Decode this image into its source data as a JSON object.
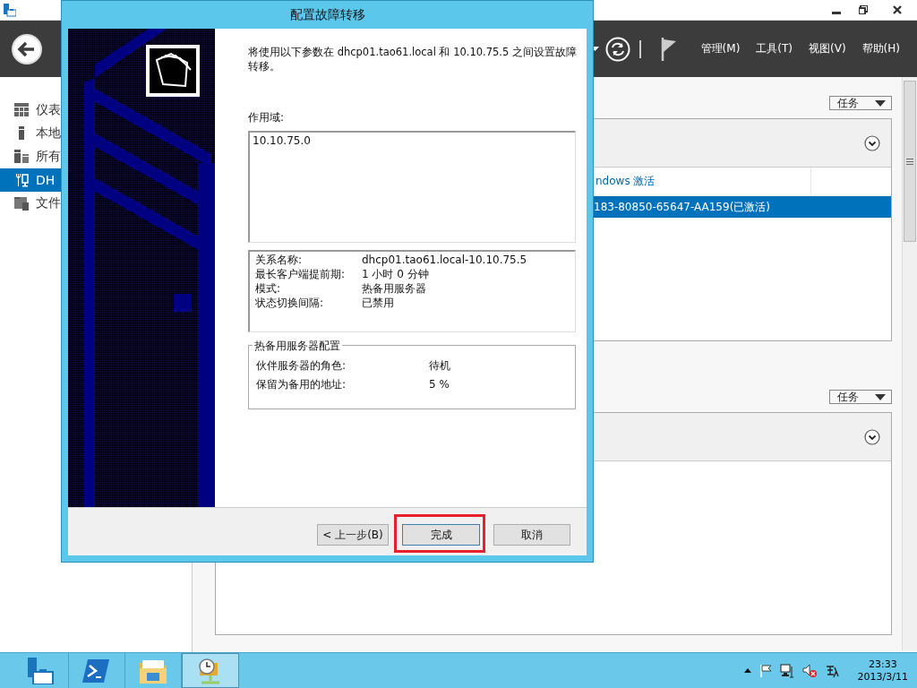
{
  "window": {
    "menu": [
      {
        "label": "管理(M)"
      },
      {
        "label": "工具(T)"
      },
      {
        "label": "视图(V)"
      },
      {
        "label": "帮助(H)"
      }
    ]
  },
  "sidebar": {
    "items": [
      {
        "label": "仪表",
        "selected": false
      },
      {
        "label": "本地",
        "selected": false
      },
      {
        "label": "所有",
        "selected": false
      },
      {
        "label": "DH",
        "selected": true
      },
      {
        "label": "文件",
        "selected": false
      }
    ]
  },
  "panels": [
    {
      "tasks": "任务",
      "column": "ndows 激活",
      "rows": [
        {
          "text": "183-80850-65647-AA159(已激活)",
          "selected": true
        }
      ]
    },
    {
      "tasks": "任务"
    }
  ],
  "dialog": {
    "title": "配置故障转移",
    "intro": "将使用以下参数在 dhcp01.tao61.local 和 10.10.75.5 之间设置故障转移。",
    "scope_label": "作用域:",
    "scopes": [
      "10.10.75.0"
    ],
    "summary": [
      {
        "label": "关系名称:",
        "value": "dhcp01.tao61.local-10.10.75.5"
      },
      {
        "label": "最长客户端提前期:",
        "value": "1 小时 0 分钟"
      },
      {
        "label": "模式:",
        "value": "热备用服务器"
      },
      {
        "label": "状态切换间隔:",
        "value": "已禁用"
      }
    ],
    "group": {
      "legend": "热备用服务器配置",
      "rows": [
        {
          "label": "伙伴服务器的角色:",
          "value": "待机"
        },
        {
          "label": "保留为备用的地址:",
          "value": "5 %"
        }
      ]
    },
    "buttons": [
      {
        "label": "< 上一步(B)",
        "kind": "back",
        "highlighted": false
      },
      {
        "label": "完成",
        "kind": "finish",
        "highlighted": true
      },
      {
        "label": "取消",
        "kind": "cancel",
        "highlighted": false
      }
    ]
  },
  "taskbar": {
    "apps": [
      {
        "selected": false
      },
      {
        "selected": false
      },
      {
        "selected": false
      },
      {
        "selected": true
      }
    ],
    "time": "23:33",
    "date": "2013/3/11"
  }
}
